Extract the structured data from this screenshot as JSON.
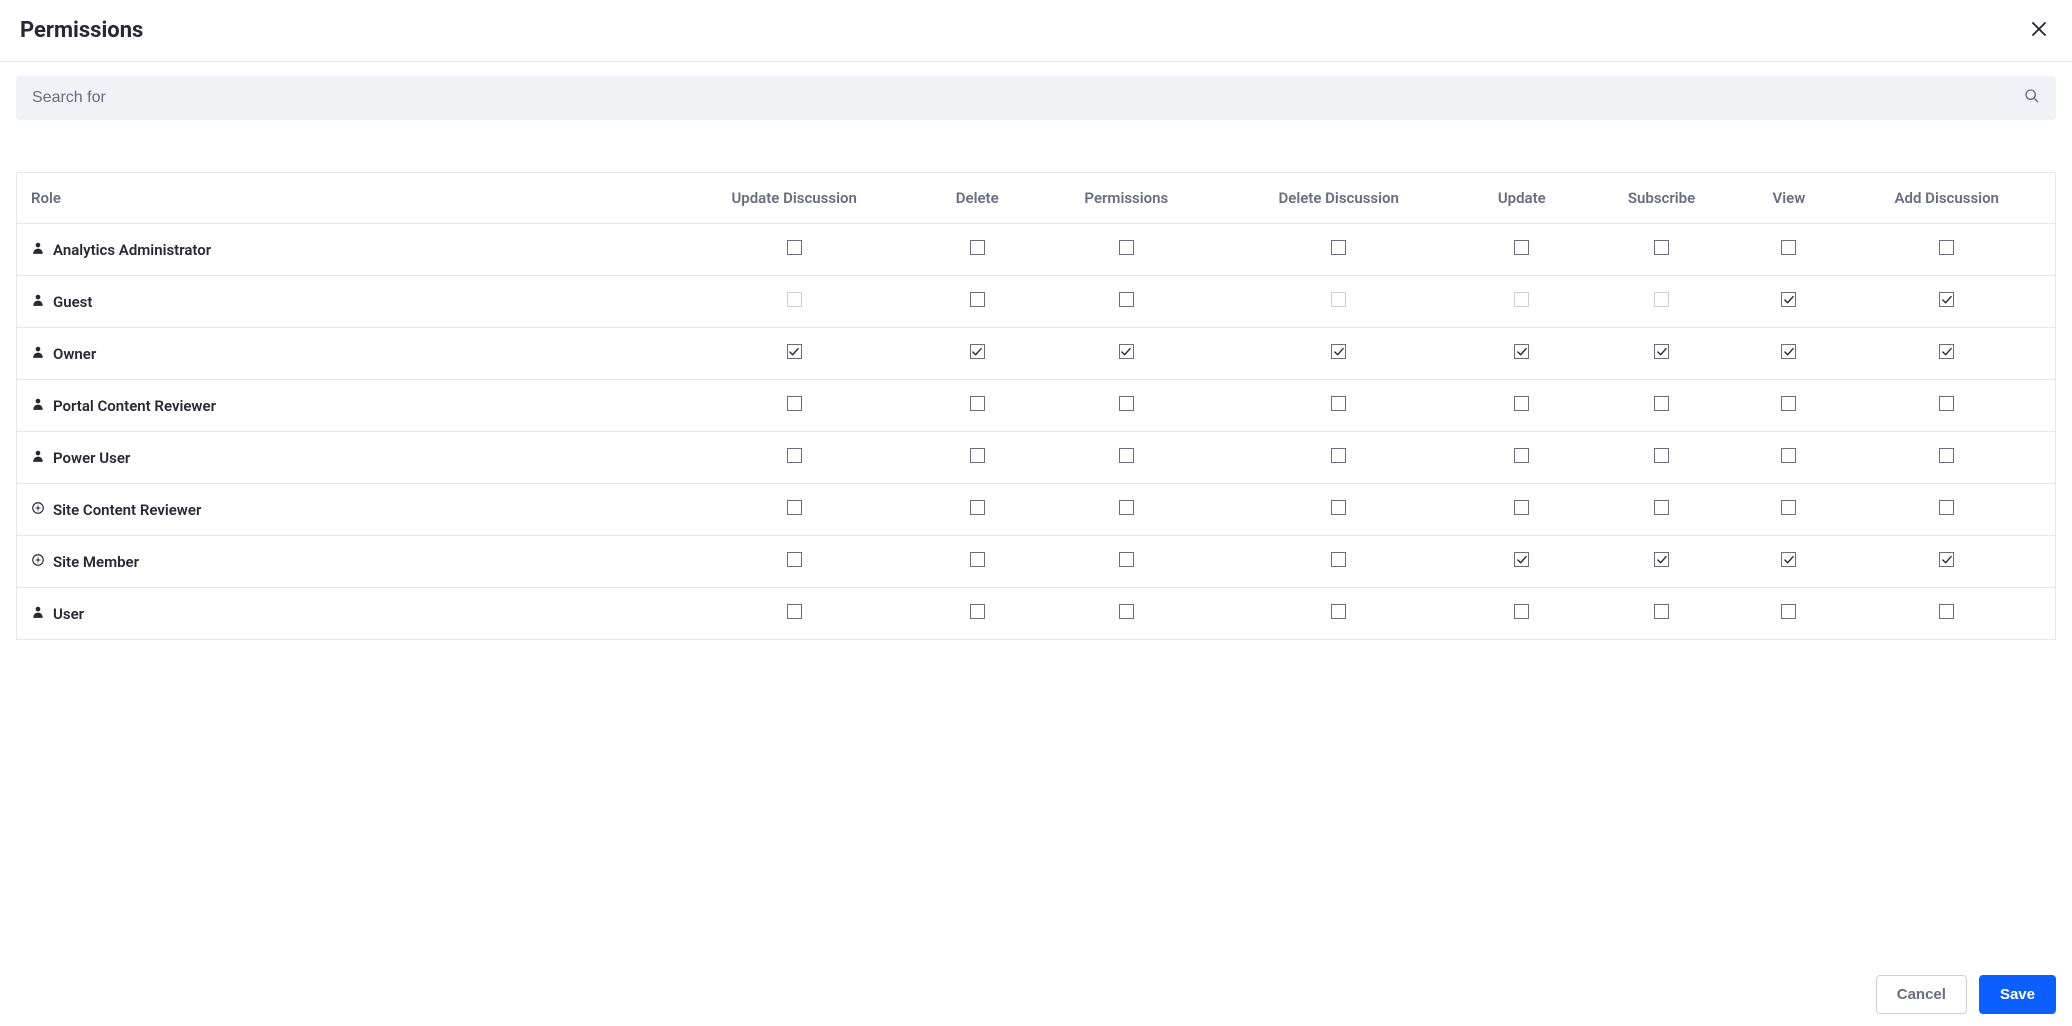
{
  "header": {
    "title": "Permissions"
  },
  "search": {
    "placeholder": "Search for"
  },
  "table": {
    "columns": {
      "role": "Role",
      "update_discussion": "Update Discussion",
      "delete": "Delete",
      "permissions": "Permissions",
      "delete_discussion": "Delete Discussion",
      "update": "Update",
      "subscribe": "Subscribe",
      "view": "View",
      "add_discussion": "Add Discussion"
    },
    "rows": [
      {
        "name": "Analytics Administrator",
        "icon": "user",
        "perms": {
          "update_discussion": {
            "checked": false,
            "disabled": false
          },
          "delete": {
            "checked": false,
            "disabled": false
          },
          "permissions": {
            "checked": false,
            "disabled": false
          },
          "delete_discussion": {
            "checked": false,
            "disabled": false
          },
          "update": {
            "checked": false,
            "disabled": false
          },
          "subscribe": {
            "checked": false,
            "disabled": false
          },
          "view": {
            "checked": false,
            "disabled": false
          },
          "add_discussion": {
            "checked": false,
            "disabled": false
          }
        }
      },
      {
        "name": "Guest",
        "icon": "user",
        "perms": {
          "update_discussion": {
            "checked": false,
            "disabled": true
          },
          "delete": {
            "checked": false,
            "disabled": false
          },
          "permissions": {
            "checked": false,
            "disabled": false
          },
          "delete_discussion": {
            "checked": false,
            "disabled": true
          },
          "update": {
            "checked": false,
            "disabled": true
          },
          "subscribe": {
            "checked": false,
            "disabled": true
          },
          "view": {
            "checked": true,
            "disabled": false
          },
          "add_discussion": {
            "checked": true,
            "disabled": false
          }
        }
      },
      {
        "name": "Owner",
        "icon": "user",
        "perms": {
          "update_discussion": {
            "checked": true,
            "disabled": false
          },
          "delete": {
            "checked": true,
            "disabled": false
          },
          "permissions": {
            "checked": true,
            "disabled": false
          },
          "delete_discussion": {
            "checked": true,
            "disabled": false
          },
          "update": {
            "checked": true,
            "disabled": false
          },
          "subscribe": {
            "checked": true,
            "disabled": false
          },
          "view": {
            "checked": true,
            "disabled": false
          },
          "add_discussion": {
            "checked": true,
            "disabled": false
          }
        }
      },
      {
        "name": "Portal Content Reviewer",
        "icon": "user",
        "perms": {
          "update_discussion": {
            "checked": false,
            "disabled": false
          },
          "delete": {
            "checked": false,
            "disabled": false
          },
          "permissions": {
            "checked": false,
            "disabled": false
          },
          "delete_discussion": {
            "checked": false,
            "disabled": false
          },
          "update": {
            "checked": false,
            "disabled": false
          },
          "subscribe": {
            "checked": false,
            "disabled": false
          },
          "view": {
            "checked": false,
            "disabled": false
          },
          "add_discussion": {
            "checked": false,
            "disabled": false
          }
        }
      },
      {
        "name": "Power User",
        "icon": "user",
        "perms": {
          "update_discussion": {
            "checked": false,
            "disabled": false
          },
          "delete": {
            "checked": false,
            "disabled": false
          },
          "permissions": {
            "checked": false,
            "disabled": false
          },
          "delete_discussion": {
            "checked": false,
            "disabled": false
          },
          "update": {
            "checked": false,
            "disabled": false
          },
          "subscribe": {
            "checked": false,
            "disabled": false
          },
          "view": {
            "checked": false,
            "disabled": false
          },
          "add_discussion": {
            "checked": false,
            "disabled": false
          }
        }
      },
      {
        "name": "Site Content Reviewer",
        "icon": "site",
        "perms": {
          "update_discussion": {
            "checked": false,
            "disabled": false
          },
          "delete": {
            "checked": false,
            "disabled": false
          },
          "permissions": {
            "checked": false,
            "disabled": false
          },
          "delete_discussion": {
            "checked": false,
            "disabled": false
          },
          "update": {
            "checked": false,
            "disabled": false
          },
          "subscribe": {
            "checked": false,
            "disabled": false
          },
          "view": {
            "checked": false,
            "disabled": false
          },
          "add_discussion": {
            "checked": false,
            "disabled": false
          }
        }
      },
      {
        "name": "Site Member",
        "icon": "site",
        "perms": {
          "update_discussion": {
            "checked": false,
            "disabled": false
          },
          "delete": {
            "checked": false,
            "disabled": false
          },
          "permissions": {
            "checked": false,
            "disabled": false
          },
          "delete_discussion": {
            "checked": false,
            "disabled": false
          },
          "update": {
            "checked": true,
            "disabled": false
          },
          "subscribe": {
            "checked": true,
            "disabled": false
          },
          "view": {
            "checked": true,
            "disabled": false
          },
          "add_discussion": {
            "checked": true,
            "disabled": false
          }
        }
      },
      {
        "name": "User",
        "icon": "user",
        "perms": {
          "update_discussion": {
            "checked": false,
            "disabled": false
          },
          "delete": {
            "checked": false,
            "disabled": false
          },
          "permissions": {
            "checked": false,
            "disabled": false
          },
          "delete_discussion": {
            "checked": false,
            "disabled": false
          },
          "update": {
            "checked": false,
            "disabled": false
          },
          "subscribe": {
            "checked": false,
            "disabled": false
          },
          "view": {
            "checked": false,
            "disabled": false
          },
          "add_discussion": {
            "checked": false,
            "disabled": false
          }
        }
      }
    ]
  },
  "footer": {
    "cancel": "Cancel",
    "save": "Save"
  }
}
